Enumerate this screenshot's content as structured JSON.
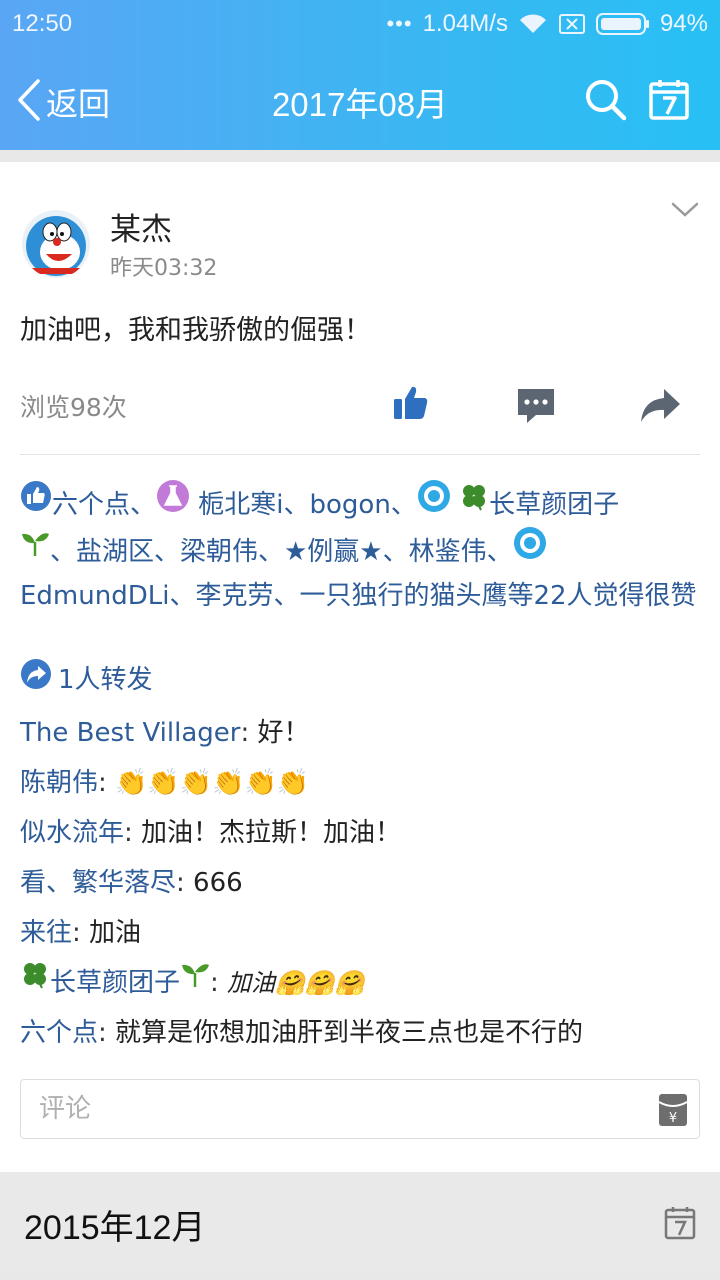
{
  "status_bar": {
    "time": "12:50",
    "dots": "•••",
    "speed": "1.04M/s",
    "battery": "94%"
  },
  "nav": {
    "back_label": "返回",
    "title": "2017年08月"
  },
  "post": {
    "user_name": "某杰",
    "time": "昨天03:32",
    "text": "加油吧，我和我骄傲的倔强！",
    "views": "浏览98次"
  },
  "likes": {
    "n1": "六个点、",
    "n2": " 栀北寒i、bogon、",
    "n3": "长草颜团子",
    "n4": "、盐湖区、梁朝伟、★例赢★、林鉴伟、",
    "n5": "EdmundDLi、李克劳、一只独行的猫头鹰等22人觉得很赞"
  },
  "forward": {
    "label": "1人转发"
  },
  "comments": [
    {
      "user": "The Best Villager",
      "text": "好！"
    },
    {
      "user": "陈朝伟",
      "text": "👏👏👏👏👏👏"
    },
    {
      "user": "似水流年",
      "text": "加油！杰拉斯！加油！"
    },
    {
      "user": "看、繁华落尽",
      "text": "666"
    },
    {
      "user": "来往",
      "text": "加油"
    },
    {
      "user": "长草颜团子",
      "text": "加油🤗🤗🤗"
    },
    {
      "user": "六个点",
      "text": "就算是你想加油肝到半夜三点也是不行的"
    }
  ],
  "comment_input": {
    "placeholder": "评论"
  },
  "next_month": {
    "label": "2015年12月"
  },
  "colors": {
    "link": "#2e5c99",
    "header_start": "#5aa6f5",
    "header_end": "#27c0f4"
  }
}
